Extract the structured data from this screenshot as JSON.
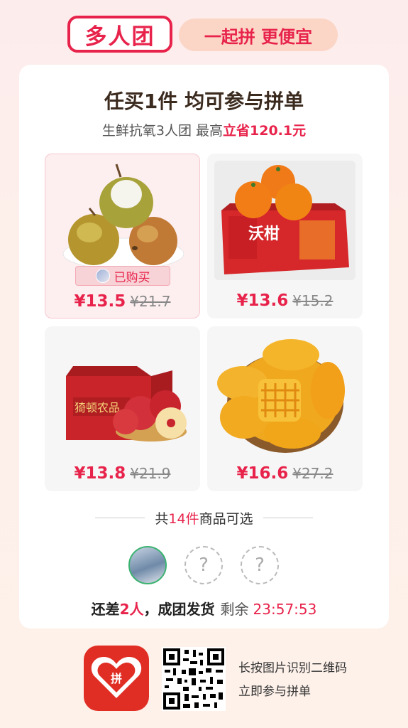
{
  "header": {
    "brand": "多人团",
    "slogan": "一起拼 更便宜"
  },
  "card": {
    "title": "任买1件 均可参与拼单",
    "subtitle_prefix": "生鲜抗氧3人团 最高",
    "subtitle_highlight": "立省120.1元"
  },
  "products": [
    {
      "price": "¥13.5",
      "old_price": "¥21.7",
      "bought_label": "已购买",
      "icon": "pears-image"
    },
    {
      "price": "¥13.6",
      "old_price": "¥15.2",
      "icon": "oranges-box-image",
      "box_text": "沃柑"
    },
    {
      "price": "¥13.8",
      "old_price": "¥21.9",
      "icon": "apples-box-image",
      "box_text": "猗顿农品"
    },
    {
      "price": "¥16.6",
      "old_price": "¥27.2",
      "icon": "mangoes-image"
    }
  ],
  "count": {
    "prefix": "共",
    "number": "14件",
    "suffix": "商品可选"
  },
  "group": {
    "missing_prefix": "还差",
    "missing_count": "2人",
    "missing_suffix": "，成团发货",
    "remaining_label": "剩余",
    "timer": "23:57:53",
    "placeholder": "?"
  },
  "footer": {
    "line1": "长按图片识别二维码",
    "line2": "立即参与拼单",
    "logo_text": "拼"
  },
  "colors": {
    "accent": "#e8234b",
    "app_red": "#e02e24",
    "pill": "#fbd6c7"
  }
}
